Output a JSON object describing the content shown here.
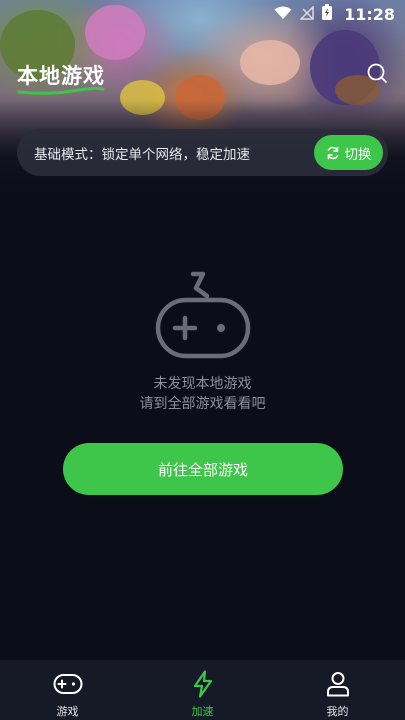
{
  "status_bar": {
    "time": "11:28"
  },
  "header": {
    "title": "本地游戏"
  },
  "mode_bar": {
    "text": "基础模式：锁定单个网络，稳定加速",
    "switch_label": "切换"
  },
  "empty_state": {
    "line1": "未发现本地游戏",
    "line2": "请到全部游戏看看吧",
    "button_label": "前往全部游戏"
  },
  "bottom_nav": {
    "items": [
      {
        "label": "游戏",
        "icon": "gamepad-icon"
      },
      {
        "label": "加速",
        "icon": "lightning-icon",
        "active": true
      },
      {
        "label": "我的",
        "icon": "user-icon"
      }
    ]
  },
  "colors": {
    "accent": "#3ec64a",
    "background": "#0b0d19",
    "muted_text": "#8e8f98"
  }
}
